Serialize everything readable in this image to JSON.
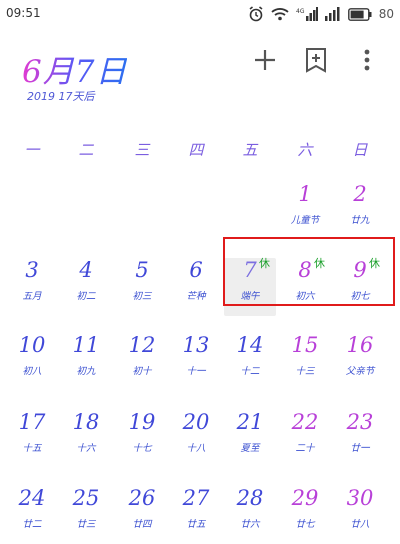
{
  "status_bar": {
    "time": "09:51",
    "battery": "80"
  },
  "header": {
    "title": "6月7日",
    "subtitle": "2019 17天后"
  },
  "toolbar": {
    "add_icon": "plus-icon",
    "bookmark_icon": "bookmark-add-icon",
    "more_icon": "more-vertical-icon"
  },
  "weekdays": [
    "一",
    "二",
    "三",
    "四",
    "五",
    "六",
    "日"
  ],
  "weeks": [
    [
      {
        "d": "",
        "s": ""
      },
      {
        "d": "",
        "s": ""
      },
      {
        "d": "",
        "s": ""
      },
      {
        "d": "",
        "s": ""
      },
      {
        "d": "",
        "s": ""
      },
      {
        "d": "1",
        "s": "儿童节"
      },
      {
        "d": "2",
        "s": "廿九"
      }
    ],
    [
      {
        "d": "3",
        "s": "五月"
      },
      {
        "d": "4",
        "s": "初二"
      },
      {
        "d": "5",
        "s": "初三"
      },
      {
        "d": "6",
        "s": "芒种"
      },
      {
        "d": "7",
        "s": "端午",
        "tag": "休",
        "today": true
      },
      {
        "d": "8",
        "s": "初六",
        "tag": "休"
      },
      {
        "d": "9",
        "s": "初七",
        "tag": "休"
      }
    ],
    [
      {
        "d": "10",
        "s": "初八"
      },
      {
        "d": "11",
        "s": "初九"
      },
      {
        "d": "12",
        "s": "初十"
      },
      {
        "d": "13",
        "s": "十一"
      },
      {
        "d": "14",
        "s": "十二"
      },
      {
        "d": "15",
        "s": "十三"
      },
      {
        "d": "16",
        "s": "父亲节"
      }
    ],
    [
      {
        "d": "17",
        "s": "十五"
      },
      {
        "d": "18",
        "s": "十六"
      },
      {
        "d": "19",
        "s": "十七"
      },
      {
        "d": "20",
        "s": "十八"
      },
      {
        "d": "21",
        "s": "夏至"
      },
      {
        "d": "22",
        "s": "二十"
      },
      {
        "d": "23",
        "s": "廿一"
      }
    ],
    [
      {
        "d": "24",
        "s": "廿二"
      },
      {
        "d": "25",
        "s": "廿三"
      },
      {
        "d": "26",
        "s": "廿四"
      },
      {
        "d": "27",
        "s": "廿五"
      },
      {
        "d": "28",
        "s": "廿六"
      },
      {
        "d": "29",
        "s": "廿七"
      },
      {
        "d": "30",
        "s": "廿八"
      }
    ]
  ],
  "colors": {
    "accent": "#4048d8",
    "holiday_tag": "#1ca02c",
    "highlight_box": "#e01b1b"
  }
}
